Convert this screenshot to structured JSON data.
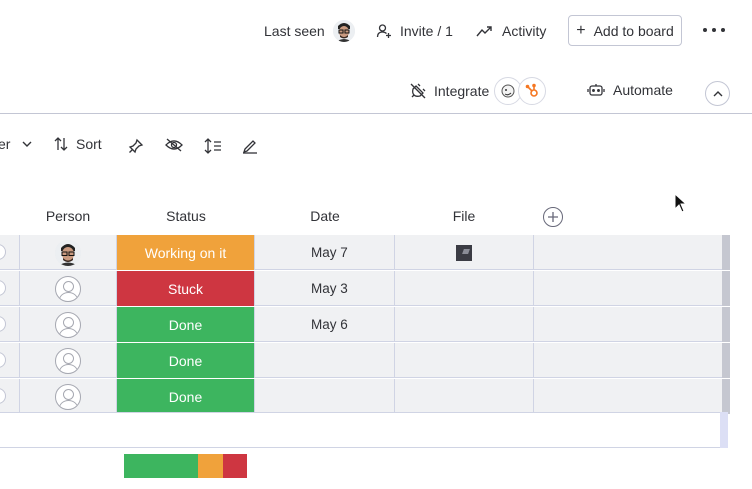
{
  "header": {
    "last_seen_label": "Last seen",
    "invite_label": "Invite / 1",
    "activity_label": "Activity",
    "add_to_board_label": "Add to board"
  },
  "actions": {
    "integrate_label": "Integrate",
    "automate_label": "Automate"
  },
  "toolbar": {
    "filter_tail": "er",
    "sort_label": "Sort"
  },
  "table": {
    "columns": {
      "person": "Person",
      "status": "Status",
      "date": "Date",
      "file": "File"
    },
    "rows": [
      {
        "person": "photo",
        "status": "Working on it",
        "status_color": "#F0A23B",
        "date": "May 7",
        "file": true
      },
      {
        "person": "empty",
        "status": "Stuck",
        "status_color": "#CE3641",
        "date": "May 3",
        "file": false
      },
      {
        "person": "empty",
        "status": "Done",
        "status_color": "#3DB55F",
        "date": "May 6",
        "file": false
      },
      {
        "person": "empty",
        "status": "Done",
        "status_color": "#3DB55F",
        "date": "",
        "file": false
      },
      {
        "person": "empty",
        "status": "Done",
        "status_color": "#3DB55F",
        "date": "",
        "file": false
      }
    ]
  },
  "status_summary": [
    {
      "status": "Done",
      "count": 3,
      "color": "#3DB55F"
    },
    {
      "status": "Working on it",
      "count": 1,
      "color": "#F0A23B"
    },
    {
      "status": "Stuck",
      "count": 1,
      "color": "#CE3641"
    }
  ],
  "icons": {
    "invite": "person-plus-icon",
    "activity": "trend-icon",
    "integrate": "plug-icon",
    "automate": "robot-icon",
    "sort": "sort-icon",
    "pin": "pin-icon",
    "hide": "eye-off-icon",
    "row_height": "row-height-icon",
    "color": "pen-icon"
  }
}
